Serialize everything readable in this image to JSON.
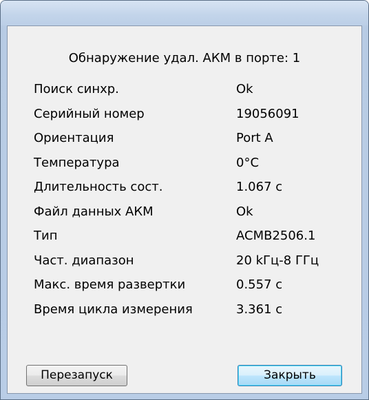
{
  "dialog": {
    "heading": "Обнаружение удал. АКМ в порте: 1",
    "rows": [
      {
        "label": "Поиск синхр.",
        "value": "Ok"
      },
      {
        "label": "Серийный номер",
        "value": "19056091"
      },
      {
        "label": "Ориентация",
        "value": "Port A"
      },
      {
        "label": "Температура",
        "value": "0°C"
      },
      {
        "label": "Длительность сост.",
        "value": "1.067 с"
      },
      {
        "label": "Файл данных АКМ",
        "value": "Ok"
      },
      {
        "label": "Тип",
        "value": "ACMB2506.1"
      },
      {
        "label": "Част. диапазон",
        "value": "20 kГц-8 ГГц"
      },
      {
        "label": "Макс. время развертки",
        "value": "0.557 с"
      },
      {
        "label": "Время цикла измерения",
        "value": "3.361 с"
      }
    ],
    "buttons": {
      "restart": "Перезапуск",
      "close": "Закрыть"
    }
  }
}
